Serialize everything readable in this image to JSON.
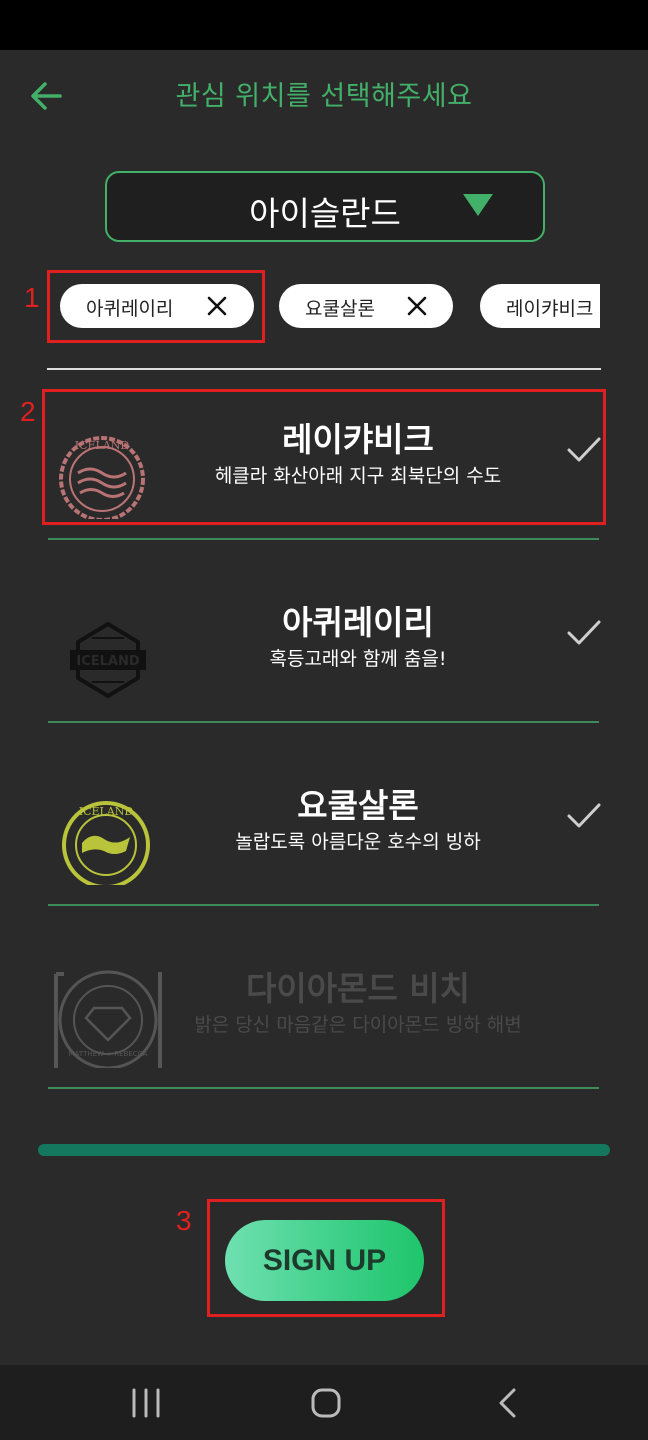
{
  "header": {
    "title": "관심 위치를 선택해주세요"
  },
  "region_select": {
    "value": "아이슬란드"
  },
  "selected_chips": [
    {
      "label": "아퀴레이리"
    },
    {
      "label": "요쿨살론"
    },
    {
      "label": "레이캬비크"
    }
  ],
  "locations": [
    {
      "name": "레이캬비크",
      "desc": "헤클라 화산아래 지구 최북단의 수도",
      "selected": true,
      "stamp_text": "ICELAND"
    },
    {
      "name": "아퀴레이리",
      "desc": "혹등고래와 함께 춤을!",
      "selected": true,
      "stamp_text": "ICELAND"
    },
    {
      "name": "요쿨살론",
      "desc": "놀랍도록 아름다운 호수의 빙하",
      "selected": true,
      "stamp_text": "ICELAND"
    },
    {
      "name": "다이아몬드 비치",
      "desc": "밝은 당신 마음같은 다이아몬드 빙하 해변",
      "selected": false,
      "stamp_text": "MATTHEW + REBECCA"
    }
  ],
  "progress": 1.0,
  "signup": {
    "label": "SIGN UP"
  },
  "annotations": [
    "1",
    "2",
    "3"
  ],
  "colors": {
    "accent": "#43b069",
    "annotation": "#e02020",
    "background": "#2a2a2a",
    "button_gradient_start": "#6fe0b0",
    "button_gradient_end": "#1fc56b"
  }
}
